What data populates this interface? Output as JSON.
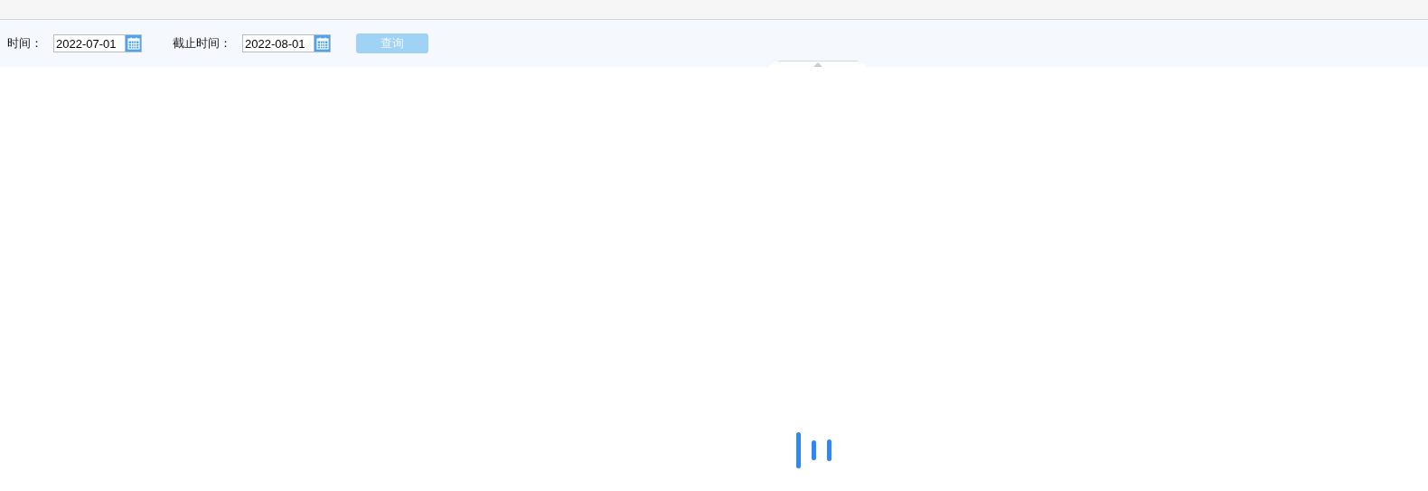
{
  "filters": [
    {
      "label": "时间：",
      "value": "2022-07-01"
    },
    {
      "label": "截止时间：",
      "value": "2022-08-01"
    }
  ],
  "query_button": {
    "label": "查询",
    "disabled": true
  },
  "loading": true
}
